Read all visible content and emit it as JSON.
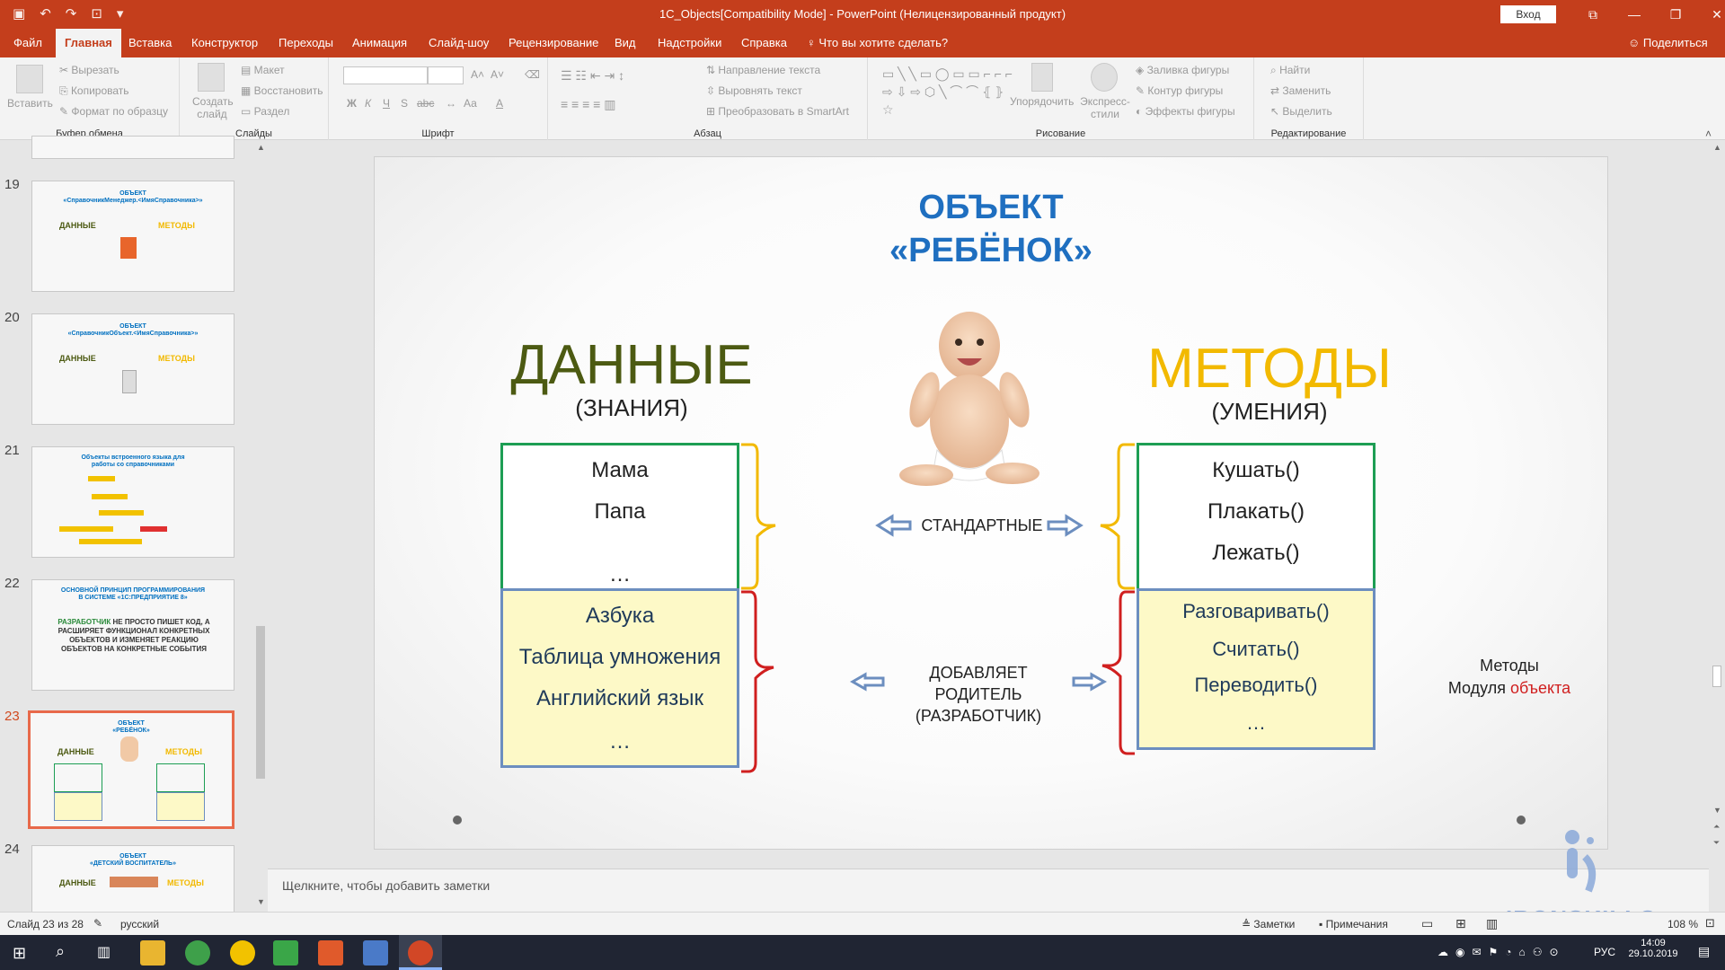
{
  "window": {
    "title": "1C_Objects[Compatibility Mode] - PowerPoint (Нелицензированный продукт)",
    "login": "Вход"
  },
  "tabs": [
    "Файл",
    "Главная",
    "Вставка",
    "Конструктор",
    "Переходы",
    "Анимация",
    "Слайд-шоу",
    "Рецензирование",
    "Вид",
    "Надстройки",
    "Справка"
  ],
  "search_label": "Что вы хотите сделать?",
  "share_label": "Поделиться",
  "ribbon": {
    "clipboard": {
      "paste": "Вставить",
      "cut": "Вырезать",
      "copy": "Копировать",
      "format": "Формат по образцу",
      "label": "Буфер обмена"
    },
    "slides": {
      "new_slide": "Создать слайд",
      "layout": "Макет",
      "reset": "Восстановить",
      "section": "Раздел",
      "label": "Слайды"
    },
    "font": {
      "label": "Шрифт",
      "bold": "Ж",
      "italic": "К",
      "underline": "Ч",
      "shadow": "S",
      "strike": "abc",
      "case": "Аа",
      "color": "А"
    },
    "paragraph": {
      "direction": "Направление текста",
      "align": "Выровнять текст",
      "smartart": "Преобразовать в SmartArt",
      "label": "Абзац"
    },
    "drawing": {
      "arrange": "Упорядочить",
      "quick_styles": "Экспресс-стили",
      "fill": "Заливка фигуры",
      "outline": "Контур фигуры",
      "effects": "Эффекты фигуры",
      "label": "Рисование"
    },
    "editing": {
      "find": "Найти",
      "replace": "Заменить",
      "select": "Выделить",
      "label": "Редактирование"
    }
  },
  "thumbnails": [
    {
      "num": "19",
      "title1": "ОБЪЕКТ",
      "title2": "«СправочникМенеджер.<ИмяСправочника>»",
      "left": "ДАННЫЕ",
      "right": "МЕТОДЫ"
    },
    {
      "num": "20",
      "title1": "ОБЪЕКТ",
      "title2": "«СправочникОбъект.<ИмяСправочника>»",
      "left": "ДАННЫЕ",
      "right": "МЕТОДЫ"
    },
    {
      "num": "21",
      "title1": "Объекты встроенного языка для",
      "title2": "работы со справочниками"
    },
    {
      "num": "22",
      "title1": "ОСНОВНОЙ ПРИНЦИП ПРОГРАММИРОВАНИЯ",
      "title2": "В СИСТЕМЕ «1С:ПРЕДПРИЯТИЕ 8»",
      "body_green": "РАЗРАБОТЧИК",
      "body": "НЕ ПРОСТО ПИШЕТ КОД, А РАСШИРЯЕТ ФУНКЦИОНАЛ КОНКРЕТНЫХ ОБЪЕКТОВ И ИЗМЕНЯЕТ РЕАКЦИЮ ОБЪЕКТОВ НА КОНКРЕТНЫЕ СОБЫТИЯ"
    },
    {
      "num": "23",
      "title1": "ОБЪЕКТ",
      "title2": "«РЕБЁНОК»",
      "left": "ДАННЫЕ",
      "right": "МЕТОДЫ"
    },
    {
      "num": "24",
      "title1": "ОБЪЕКТ",
      "title2": "«ДЕТСКИЙ ВОСПИТАТЕЛЬ»",
      "left": "ДАННЫЕ",
      "right": "МЕТОДЫ"
    }
  ],
  "slide": {
    "title_line1": "ОБЪЕКТ",
    "title_line2": "«РЕБЁНОК»",
    "left_heading": "ДАННЫЕ",
    "left_sub": "(ЗНАНИЯ)",
    "right_heading": "МЕТОДЫ",
    "right_sub": "(УМЕНИЯ)",
    "left_top": [
      "Мама",
      "Папа",
      "…"
    ],
    "left_bottom": [
      "Азбука",
      "Таблица умножения",
      "Английский язык",
      "…"
    ],
    "right_top": [
      "Кушать()",
      "Плакать()",
      "Лежать()",
      "…"
    ],
    "right_bottom": [
      "Разговаривать()",
      "Считать()",
      "Переводить()",
      "…"
    ],
    "middle_top": "СТАНДАРТНЫЕ",
    "middle_bottom": [
      "ДОБАВЛЯЕТ",
      "РОДИТЕЛЬ",
      "(РАЗРАБОТЧИК)"
    ],
    "note_line1": "Методы",
    "note_line2_black": "Модуля ",
    "note_line2_red": "объекта"
  },
  "notes_placeholder": "Щелкните, чтобы добавить заметки",
  "status": {
    "slide_info": "Слайд 23 из 28",
    "language": "русский",
    "notes": "Заметки",
    "comments": "Примечания",
    "zoom": "108 %"
  },
  "watermark": "IRONSKILLS",
  "taskbar": {
    "lang": "РУС",
    "time": "14:09",
    "date": "29.10.2019"
  },
  "colors": {
    "accent": "#c43e1c",
    "blue_title": "#1f6fc0",
    "green_heading": "#4c5a12",
    "yellow_heading": "#f2b900",
    "green_border": "#1d9e54",
    "blue_border": "#6c8ebf",
    "yellow_fill": "#fdf9c7",
    "red_brace": "#d01f1f"
  }
}
